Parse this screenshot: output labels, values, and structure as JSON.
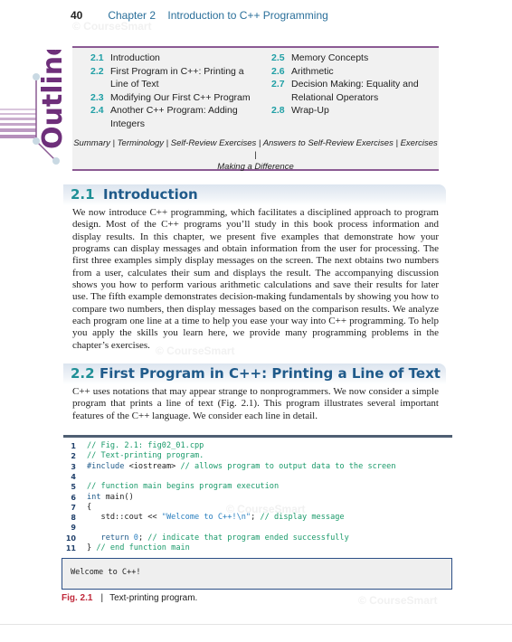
{
  "running_head": {
    "page_number": "40",
    "chapter_label": "Chapter 2",
    "chapter_title": "Introduction to C++ Programming"
  },
  "watermark": "© CourseSmart",
  "outline": {
    "label": "Outline",
    "left_items": [
      {
        "num": "2.1",
        "text": "Introduction"
      },
      {
        "num": "2.2",
        "text": "First Program in C++: Printing a Line of Text"
      },
      {
        "num": "2.3",
        "text": "Modifying Our First C++ Program"
      },
      {
        "num": "2.4",
        "text": "Another C++ Program: Adding Integers"
      }
    ],
    "right_items": [
      {
        "num": "2.5",
        "text": "Memory Concepts"
      },
      {
        "num": "2.6",
        "text": "Arithmetic"
      },
      {
        "num": "2.7",
        "text": "Decision Making: Equality and Relational Operators"
      },
      {
        "num": "2.8",
        "text": "Wrap-Up"
      }
    ],
    "end_links": [
      "Summary",
      "Terminology",
      "Self-Review Exercises",
      "Answers to Self-Review Exercises",
      "Exercises",
      "Making a Difference"
    ]
  },
  "sections": [
    {
      "num": "2.1",
      "title": "Introduction",
      "body": "We now introduce C++ programming, which facilitates a disciplined approach to program design. Most of the C++ programs you’ll study in this book process information and display results. In this chapter, we present five examples that demonstrate how your programs can display messages and obtain information from the user for processing. The first three examples simply display messages on the screen. The next obtains two numbers from a user, calculates their sum and displays the result. The accompanying discussion shows you how to perform various arithmetic calculations and save their results for later use. The fifth example demonstrates decision-making fundamentals by showing you how to compare two numbers, then display messages based on the comparison results. We analyze each program one line at a time to help you ease your way into C++ programming. To help you apply the skills you learn here, we provide many programming problems in the chapter’s exercises."
    },
    {
      "num": "2.2",
      "title": "First Program in C++: Printing a Line of Text",
      "body": "C++ uses notations that may appear strange to nonprogrammers. We now consider a simple program that prints a line of text (Fig. 2.1). This program illustrates several important features of the C++ language. We consider each line in detail."
    }
  ],
  "code_listing": {
    "lines": [
      {
        "n": "1",
        "segments": [
          {
            "t": "// Fig. 2.1: fig02_01.cpp",
            "c": "comment"
          }
        ]
      },
      {
        "n": "2",
        "segments": [
          {
            "t": "// Text-printing program.",
            "c": "comment"
          }
        ]
      },
      {
        "n": "3",
        "segments": [
          {
            "t": "#include ",
            "c": "kw"
          },
          {
            "t": "<iostream> ",
            "c": "plain"
          },
          {
            "t": "// allows program to output data to the screen",
            "c": "comment"
          }
        ]
      },
      {
        "n": "4",
        "segments": []
      },
      {
        "n": "5",
        "segments": [
          {
            "t": "// function main begins program execution",
            "c": "comment"
          }
        ]
      },
      {
        "n": "6",
        "segments": [
          {
            "t": "int ",
            "c": "kw"
          },
          {
            "t": "main()",
            "c": "plain"
          }
        ]
      },
      {
        "n": "7",
        "segments": [
          {
            "t": "{",
            "c": "plain"
          }
        ]
      },
      {
        "n": "8",
        "segments": [
          {
            "t": "   std::cout << ",
            "c": "plain"
          },
          {
            "t": "\"Welcome to C++!\\n\"",
            "c": "str"
          },
          {
            "t": "; ",
            "c": "plain"
          },
          {
            "t": "// display message",
            "c": "comment"
          }
        ]
      },
      {
        "n": "9",
        "segments": []
      },
      {
        "n": "10",
        "segments": [
          {
            "t": "   return ",
            "c": "kw"
          },
          {
            "t": "0",
            "c": "str"
          },
          {
            "t": "; ",
            "c": "plain"
          },
          {
            "t": "// indicate that program ended successfully",
            "c": "comment"
          }
        ]
      },
      {
        "n": "11",
        "segments": [
          {
            "t": "} ",
            "c": "plain"
          },
          {
            "t": "// end function main",
            "c": "comment"
          }
        ]
      }
    ],
    "output": "Welcome to C++!"
  },
  "figure_caption": {
    "label": "Fig. 2.1",
    "separator": "|",
    "text": "Text-printing program."
  },
  "colors": {
    "accent_teal": "#1f8f96",
    "heading_blue": "#1f5a8a",
    "outline_purple": "#8b5a93",
    "figure_red": "#c0283a",
    "code_comment": "#1a9a6a"
  }
}
